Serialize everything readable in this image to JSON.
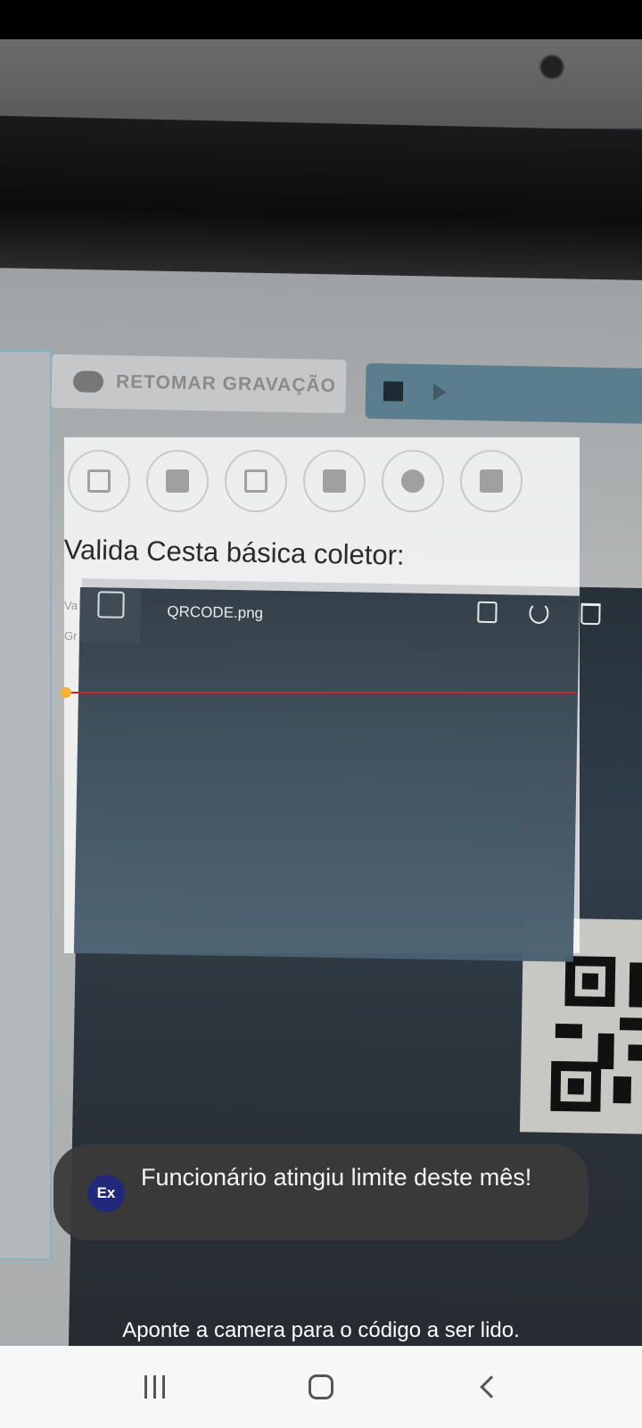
{
  "camera_view": {
    "background": {
      "record_button_label": "RETOMAR GRAVAÇÃO",
      "form_title": "Valida Cesta básica coletor:",
      "form_small_labels": [
        "Va",
        "Gr"
      ],
      "image_viewer": {
        "filename": "QRCODE.png"
      }
    }
  },
  "toast": {
    "icon_text": "Ex",
    "message": "Funcionário atingiu limite deste mês!",
    "background": "#3a3a3a",
    "icon_color": "#22297a"
  },
  "hint": {
    "text": "Aponte a camera para o código a ser lido."
  },
  "scanner": {
    "line_color": "#c62828",
    "dot_color": "#f3b331"
  },
  "nav_bar": {
    "buttons": [
      "recents",
      "home",
      "back"
    ]
  }
}
